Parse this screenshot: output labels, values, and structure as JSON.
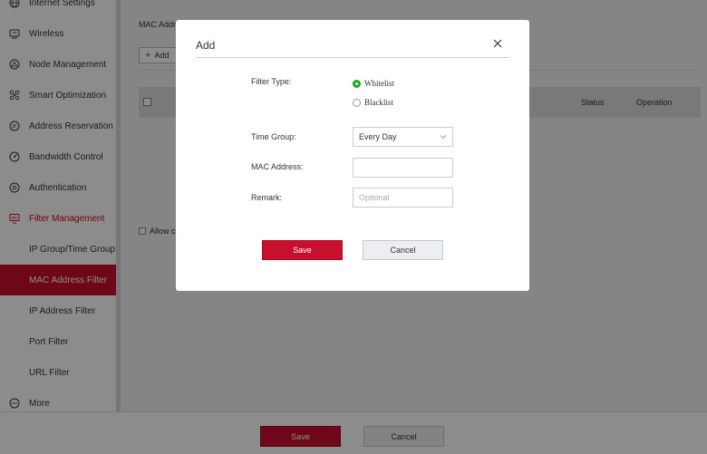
{
  "sidebar": {
    "items": [
      {
        "label": "Internet Settings",
        "icon": "globe-icon"
      },
      {
        "label": "Wireless",
        "icon": "wireless-icon"
      },
      {
        "label": "Node Management",
        "icon": "node-icon"
      },
      {
        "label": "Smart Optimization",
        "icon": "optimization-icon"
      },
      {
        "label": "Address Reservation",
        "icon": "reservation-icon"
      },
      {
        "label": "Bandwidth Control",
        "icon": "gauge-icon"
      },
      {
        "label": "Authentication",
        "icon": "authentication-icon"
      },
      {
        "label": "Filter Management",
        "icon": "filter-icon"
      },
      {
        "label": "IP Group/Time Group"
      },
      {
        "label": "MAC Address Filter"
      },
      {
        "label": "IP Address Filter"
      },
      {
        "label": "Port Filter"
      },
      {
        "label": "URL Filter"
      },
      {
        "label": "More",
        "icon": "more-icon"
      }
    ]
  },
  "main": {
    "title": "MAC Addre",
    "add_label": "Add",
    "columns": {
      "status": "Status",
      "operation": "Operation"
    },
    "allow_label": "Allow cl"
  },
  "footer": {
    "save_label": "Save",
    "cancel_label": "Cancel"
  },
  "modal": {
    "title": "Add",
    "filter_type_label": "Filter Type:",
    "filter_options": [
      "Whitelist",
      "Blacklist"
    ],
    "filter_selected": "Whitelist",
    "time_group_label": "Time Group:",
    "time_group_value": "Every Day",
    "mac_label": "MAC Address:",
    "mac_value": "",
    "remark_label": "Remark:",
    "remark_placeholder": "Optional",
    "save_label": "Save",
    "cancel_label": "Cancel"
  },
  "colors": {
    "accent": "#c8102e",
    "radio_selected": "#1aad19",
    "overlay": "rgba(0,0,0,0.45)"
  }
}
